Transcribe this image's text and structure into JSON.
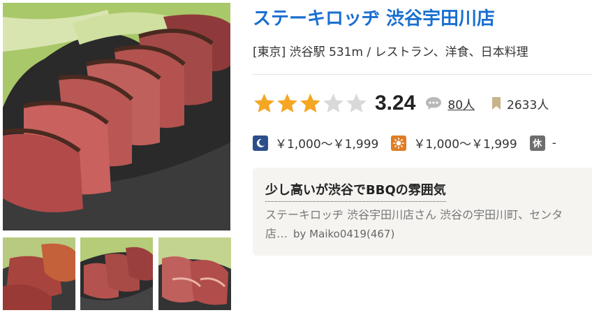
{
  "restaurant": {
    "name": "ステーキロッヂ 渋谷宇田川店",
    "area_info": "[東京] 渋谷駅 531m / レストラン、洋食、日本料理"
  },
  "rating": {
    "score": "3.24",
    "stars_value": 3.24,
    "stars_max": 5,
    "review_count": "80人",
    "bookmark_count": "2633人"
  },
  "price": {
    "dinner": "￥1,000～￥1,999",
    "lunch": "￥1,000～￥1,999",
    "holiday_label": "休",
    "holiday_value": "-"
  },
  "review": {
    "title": "少し高いが渋谷でBBQの雰囲気",
    "snippet_line1": "ステーキロッヂ 渋谷宇田川店さん 渋谷の宇田川町、センタ",
    "snippet_line2": "店…",
    "author": "by Maiko0419(467)"
  },
  "icons": {
    "star_filled_color": "#f5a623",
    "star_empty_color": "#d9d9d9",
    "title_color": "#1a6fd0",
    "dinner_icon": "moon-icon",
    "lunch_icon": "sun-icon",
    "review_icon": "speech-bubble-icon",
    "bookmark_icon": "bookmark-icon"
  }
}
